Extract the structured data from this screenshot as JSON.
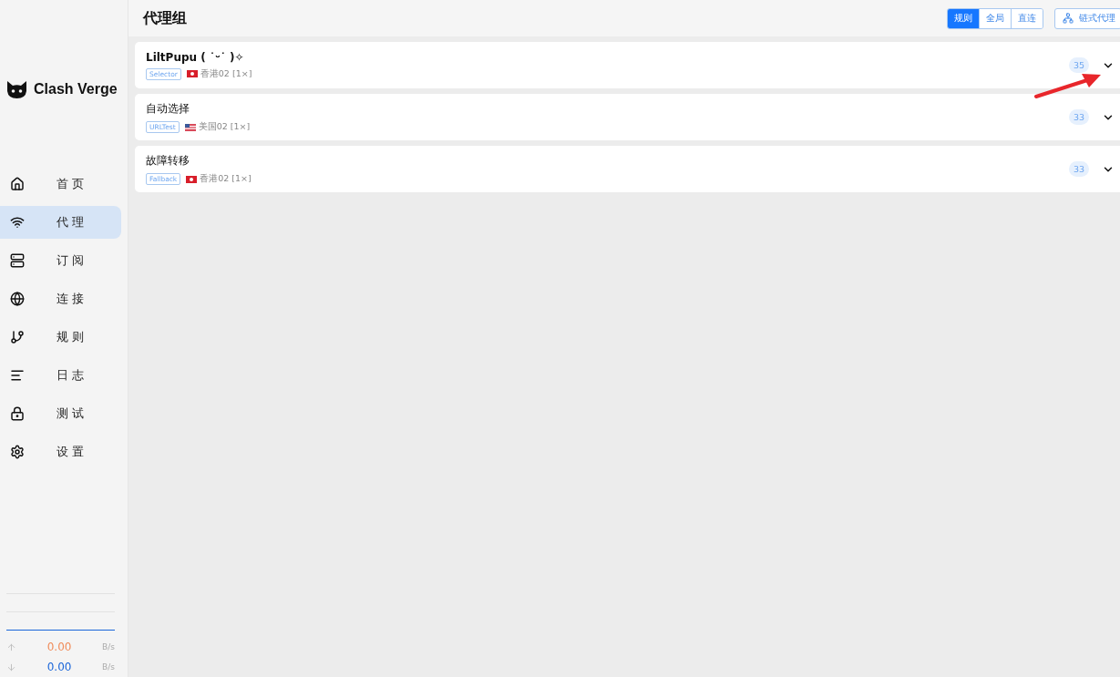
{
  "app": {
    "name": "Clash Verge"
  },
  "nav": [
    {
      "label": "首页",
      "selected": false
    },
    {
      "label": "代理",
      "selected": true
    },
    {
      "label": "订阅",
      "selected": false
    },
    {
      "label": "连接",
      "selected": false
    },
    {
      "label": "规则",
      "selected": false
    },
    {
      "label": "日志",
      "selected": false
    },
    {
      "label": "测试",
      "selected": false
    },
    {
      "label": "设置",
      "selected": false
    }
  ],
  "traffic": {
    "upload": "0.00",
    "upload_unit": "B/s",
    "download": "0.00",
    "download_unit": "B/s"
  },
  "header": {
    "title": "代理组",
    "modes": [
      {
        "label": "规则",
        "selected": true
      },
      {
        "label": "全局",
        "selected": false
      },
      {
        "label": "直连",
        "selected": false
      }
    ],
    "chain_button": "链式代理"
  },
  "groups": [
    {
      "name": "LiltPupu ( ˙ᵕ˙ )✧",
      "type": "Selector",
      "kind": "hongkong",
      "current": "香港02 [1×]",
      "count": "35",
      "annotated": true
    },
    {
      "name": "自动选择",
      "type": "URLTest",
      "kind": "usa",
      "current": "美国02 [1×]",
      "count": "33",
      "annotated": false
    },
    {
      "name": "故障转移",
      "type": "Fallback",
      "kind": "hongkong",
      "current": "香港02 [1×]",
      "count": "33",
      "annotated": false
    }
  ]
}
